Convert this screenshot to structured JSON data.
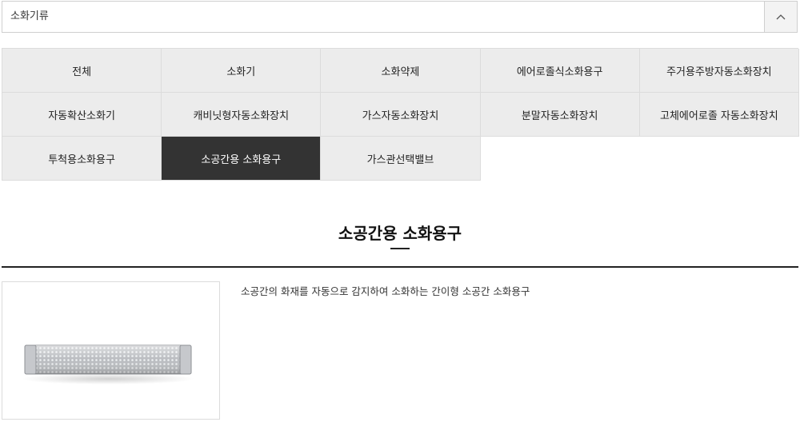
{
  "category_dropdown": {
    "label": "소화기류",
    "toggle_icon": "chevron-up-icon"
  },
  "categories": [
    {
      "label": "전체",
      "active": false
    },
    {
      "label": "소화기",
      "active": false
    },
    {
      "label": "소화약제",
      "active": false
    },
    {
      "label": "에어로졸식소화용구",
      "active": false
    },
    {
      "label": "주거용주방자동소화장치",
      "active": false
    },
    {
      "label": "자동확산소화기",
      "active": false
    },
    {
      "label": "캐비닛형자동소화장치",
      "active": false
    },
    {
      "label": "가스자동소화장치",
      "active": false
    },
    {
      "label": "분말자동소화장치",
      "active": false
    },
    {
      "label": "고체에어로졸 자동소화장치",
      "active": false
    },
    {
      "label": "투척용소화용구",
      "active": false
    },
    {
      "label": "소공간용 소화용구",
      "active": true
    },
    {
      "label": "가스관선택밸브",
      "active": false
    }
  ],
  "section": {
    "title": "소공간용 소화용구"
  },
  "product": {
    "description": "소공간의 화재를 자동으로 감지하여 소화하는 간이형 소공간 소화용구",
    "image_icon": "perforated-metal-tube-image"
  },
  "colors": {
    "cell_bg": "#ececec",
    "active_bg": "#333333",
    "active_text": "#ffffff",
    "border": "#dcdcdc"
  }
}
